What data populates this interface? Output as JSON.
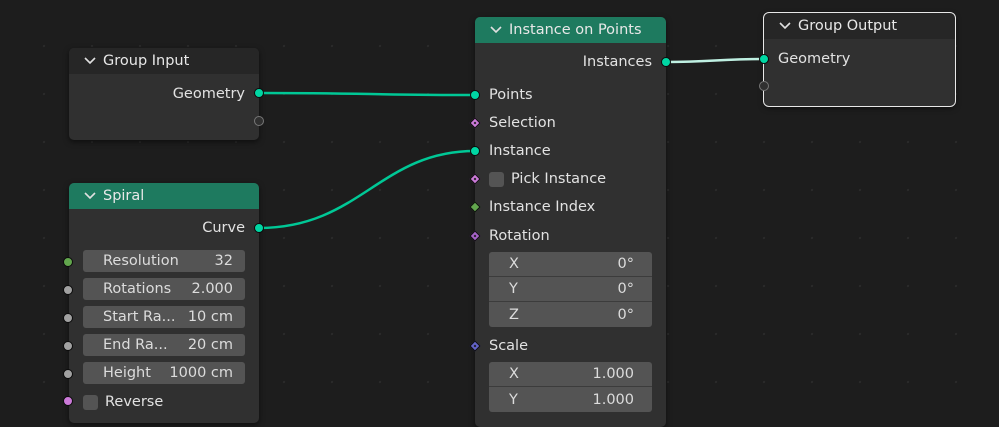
{
  "group_input": {
    "title": "Group Input",
    "outputs": [
      "Geometry"
    ]
  },
  "group_output": {
    "title": "Group Output",
    "inputs": [
      "Geometry"
    ]
  },
  "spiral": {
    "title": "Spiral",
    "output": "Curve",
    "fields": [
      {
        "label": "Resolution",
        "value": "32"
      },
      {
        "label": "Rotations",
        "value": "2.000"
      },
      {
        "label": "Start Ra...",
        "value": "10 cm"
      },
      {
        "label": "End Ra...",
        "value": "20 cm"
      },
      {
        "label": "Height",
        "value": "1000 cm"
      }
    ],
    "reverse_label": "Reverse"
  },
  "instance_on_points": {
    "title": "Instance on Points",
    "output": "Instances",
    "inputs": {
      "points": "Points",
      "selection": "Selection",
      "instance": "Instance",
      "pick_instance": "Pick Instance",
      "instance_index": "Instance Index",
      "rotation": "Rotation",
      "scale": "Scale"
    },
    "rotation": [
      {
        "axis": "X",
        "value": "0°"
      },
      {
        "axis": "Y",
        "value": "0°"
      },
      {
        "axis": "Z",
        "value": "0°"
      }
    ],
    "scale": [
      {
        "axis": "X",
        "value": "1.000"
      },
      {
        "axis": "Y",
        "value": "1.000"
      }
    ]
  },
  "colors": {
    "geometry_socket": "#00d6a3",
    "header_green": "#1e7a5f",
    "link": "#00c896",
    "link_selected": "#bff0e2",
    "vector_socket": "#6363c7",
    "integer_socket": "#62a64d",
    "rotation_socket": "#a663c7",
    "boolean_socket": "#cc7ad9"
  }
}
